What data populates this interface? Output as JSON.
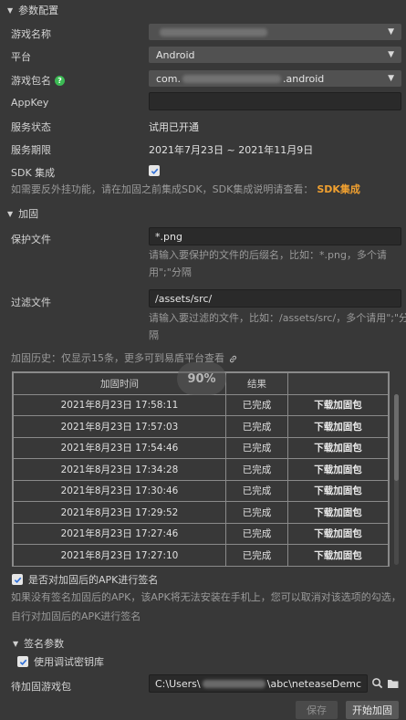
{
  "params_section": {
    "title": "参数配置"
  },
  "game_name": {
    "label": "游戏名称"
  },
  "platform": {
    "label": "平台",
    "value": "Android"
  },
  "package": {
    "label": "游戏包名",
    "prefix": "com.",
    "suffix": ".android"
  },
  "appkey": {
    "label": "AppKey",
    "value": ""
  },
  "service_status": {
    "label": "服务状态",
    "value": "试用已开通"
  },
  "service_period": {
    "label": "服务期限",
    "value": "2021年7月23日 ~ 2021年11月9日"
  },
  "sdk": {
    "label": "SDK 集成",
    "checked": true,
    "note": "如需要反外挂功能，请在加固之前集成SDK，SDK集成说明请查看：",
    "link": "SDK集成"
  },
  "harden_section": {
    "title": "加固"
  },
  "protect_file": {
    "label": "保护文件",
    "value": "*.png",
    "hint_line1": "请输入要保护的文件的后缀名，比如：*.png，多个请",
    "hint_line2": "用\";\"分隔"
  },
  "filter_file": {
    "label": "过滤文件",
    "value": "/assets/src/",
    "hint_line1": "请输入要过滤的文件，比如：/assets/src/，多个请用\";\"分",
    "hint_line2": "隔"
  },
  "history": {
    "note": "加固历史：仅显示15条，更多可到易盾平台查看",
    "progress": "90%",
    "headers": [
      "加固时间",
      "结果",
      ""
    ],
    "rows": [
      {
        "time": "2021年8月23日 17:58:11",
        "result": "已完成",
        "action": "下载加固包"
      },
      {
        "time": "2021年8月23日 17:57:03",
        "result": "已完成",
        "action": "下载加固包"
      },
      {
        "time": "2021年8月23日 17:54:46",
        "result": "已完成",
        "action": "下载加固包"
      },
      {
        "time": "2021年8月23日 17:34:28",
        "result": "已完成",
        "action": "下载加固包"
      },
      {
        "time": "2021年8月23日 17:30:46",
        "result": "已完成",
        "action": "下载加固包"
      },
      {
        "time": "2021年8月23日 17:29:52",
        "result": "已完成",
        "action": "下载加固包"
      },
      {
        "time": "2021年8月23日 17:27:46",
        "result": "已完成",
        "action": "下载加固包"
      },
      {
        "time": "2021年8月23日 17:27:10",
        "result": "已完成",
        "action": "下载加固包"
      }
    ]
  },
  "sign_apk": {
    "label": "是否对加固后的APK进行签名",
    "checked": true,
    "note_line1": "如果没有签名加固后的APK，该APK将无法安装在手机上，您可以取消对该选项的勾选，",
    "note_line2": "自行对加固后的APK进行签名"
  },
  "sign_section": {
    "title": "签名参数"
  },
  "debug_keystore": {
    "label": "使用调试密钥库",
    "checked": true
  },
  "pending_package": {
    "label": "待加固游戏包",
    "path_prefix": "C:\\Users\\",
    "path_suffix": "\\abc\\neteaseDemc"
  },
  "buttons": {
    "save": "保存",
    "start": "开始加固"
  }
}
